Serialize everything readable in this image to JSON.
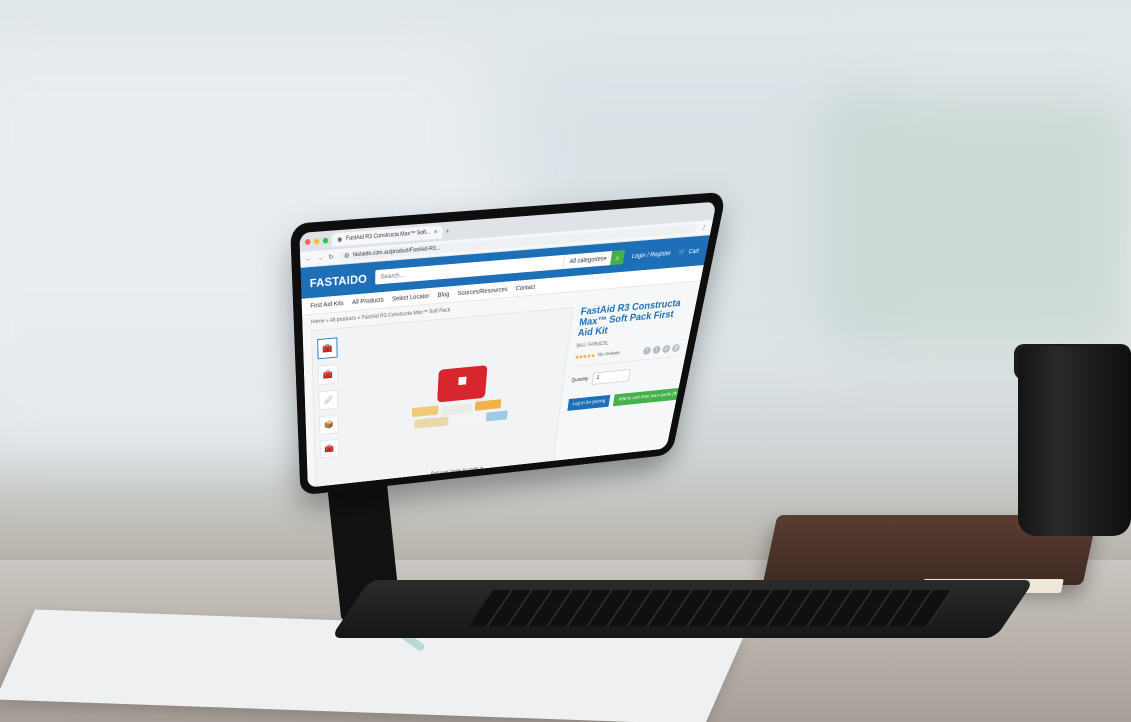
{
  "browser": {
    "tab_title": "FastAid R3 Constructa Max™ Soft...",
    "address": "fastaido.com.au/product/FastAid-R3..."
  },
  "site": {
    "logo_text": "FASTAIDO",
    "search_placeholder": "Search...",
    "category_select": "All categories",
    "login_link": "Login / Register",
    "cart_label": "Cart"
  },
  "nav": {
    "items": [
      "First Aid Kits",
      "All Products",
      "Select Locator",
      "Blog",
      "Sources/Resources",
      "Contact"
    ]
  },
  "breadcrumb": "Home » All products » FastAid R3 Constructa Max™ Soft Pack",
  "product": {
    "title": "FastAid R3 Constructa Max™ Soft Pack First Aid Kit",
    "sku": "SKU: FAR3CSL",
    "stars": "★★★★★",
    "reviews": "No reviews",
    "quantity_label": "Quantity",
    "quantity_value": "1",
    "login_button": "Log in for pricing",
    "quote_button": "Add to cart from your quote (friendly)",
    "zoom_hint": "Roll over image to zoom in"
  },
  "colors": {
    "brand_blue": "#1d6fb8",
    "accent_green": "#46b14b",
    "kit_red": "#d8262f"
  }
}
